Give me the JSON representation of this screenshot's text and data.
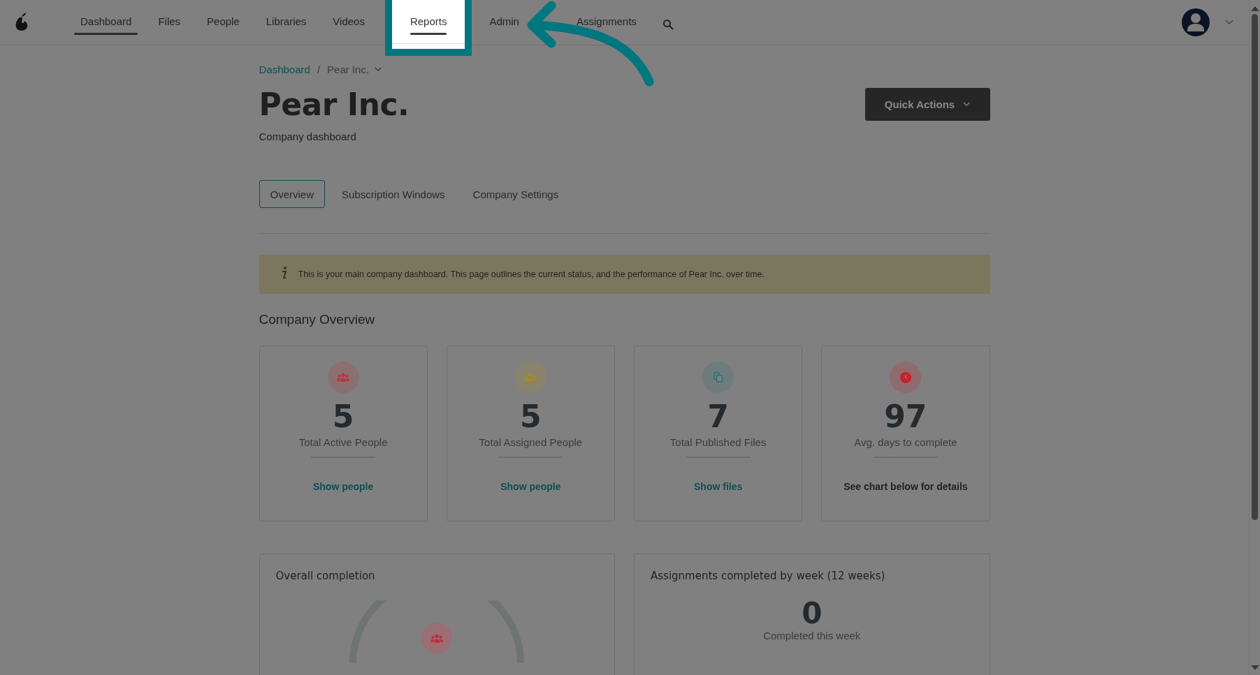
{
  "nav": {
    "items": [
      {
        "label": "Dashboard",
        "selected": true,
        "highlighted": false
      },
      {
        "label": "Files",
        "selected": false,
        "highlighted": false
      },
      {
        "label": "People",
        "selected": false,
        "highlighted": false
      },
      {
        "label": "Libraries",
        "selected": false,
        "highlighted": false
      },
      {
        "label": "Videos",
        "selected": false,
        "highlighted": false
      },
      {
        "label": "Reports",
        "selected": false,
        "highlighted": true
      },
      {
        "label": "Admin",
        "selected": false,
        "highlighted": false
      },
      {
        "label": "Assignments",
        "selected": false,
        "highlighted": false
      }
    ]
  },
  "breadcrumb": {
    "separator": "/",
    "items": [
      {
        "label": "Dashboard",
        "kind": "link"
      },
      {
        "label": "Pear Inc.",
        "kind": "current"
      }
    ]
  },
  "page": {
    "title": "Pear Inc.",
    "subtitle": "Company dashboard",
    "action": "Quick Actions"
  },
  "tabs": [
    {
      "label": "Overview",
      "selected": true
    },
    {
      "label": "Subscription Windows",
      "selected": false
    },
    {
      "label": "Company Settings",
      "selected": false
    }
  ],
  "notice": "This is your main company dashboard. This page outlines the current status, and the performance of Pear Inc. over time.",
  "section_title": "Company Overview",
  "stats": [
    {
      "kind": "people",
      "color": "#b8323d",
      "value": "5",
      "label": "Total Active People",
      "footer": "Show people",
      "footer_is_link": true
    },
    {
      "kind": "people",
      "color": "#a88b25",
      "value": "5",
      "label": "Total Assigned People",
      "footer": "Show people",
      "footer_is_link": true
    },
    {
      "kind": "files",
      "color": "#2e6f75",
      "value": "7",
      "label": "Total Published Files",
      "footer": "Show files",
      "footer_is_link": true
    },
    {
      "kind": "clock",
      "color": "#c4222f",
      "value": "97",
      "label": "Avg. days to complete",
      "footer": "See chart below for details",
      "footer_is_link": false
    }
  ],
  "panels": [
    {
      "kind": "gauge",
      "title": "Overall completion",
      "color": "#b8323d"
    },
    {
      "kind": "counter",
      "title": "Assignments completed by week (12 weeks)",
      "value": "0",
      "caption": "Completed this week"
    }
  ]
}
